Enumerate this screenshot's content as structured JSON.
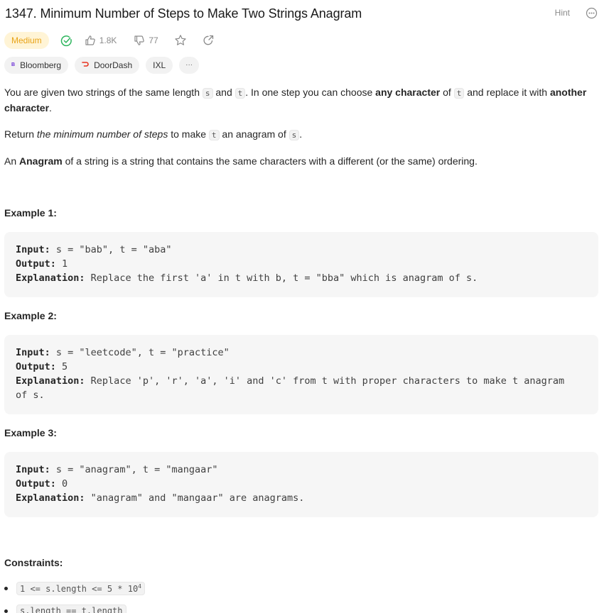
{
  "problem": {
    "title": "1347. Minimum Number of Steps to Make Two Strings Anagram",
    "hint_label": "Hint",
    "difficulty": "Medium",
    "likes": "1.8K",
    "dislikes": "77"
  },
  "companies": [
    {
      "name": "Bloomberg",
      "logo": "B"
    },
    {
      "name": "DoorDash"
    },
    {
      "name": "IXL"
    }
  ],
  "more_tags_label": "···",
  "description": {
    "p1_a": "You are given two strings of the same length ",
    "p1_s": "s",
    "p1_b": " and ",
    "p1_t": "t",
    "p1_c": ". In one step you can choose ",
    "p1_bold1": "any character",
    "p1_d": " of ",
    "p1_t2": "t",
    "p1_e": " and replace it with ",
    "p1_bold2": "another character",
    "p1_f": ".",
    "p2_a": "Return ",
    "p2_ital": "the minimum number of steps",
    "p2_b": " to make ",
    "p2_t": "t",
    "p2_c": " an anagram of ",
    "p2_s": "s",
    "p2_d": ".",
    "p3_a": "An ",
    "p3_bold": "Anagram",
    "p3_b": " of a string is a string that contains the same characters with a different (or the same) ordering."
  },
  "examples": [
    {
      "title": "Example 1:",
      "input_label": "Input:",
      "input": " s = \"bab\", t = \"aba\"",
      "output_label": "Output:",
      "output": " 1",
      "explanation_label": "Explanation:",
      "explanation": " Replace the first 'a' in t with b, t = \"bba\" which is anagram of s."
    },
    {
      "title": "Example 2:",
      "input_label": "Input:",
      "input": " s = \"leetcode\", t = \"practice\"",
      "output_label": "Output:",
      "output": " 5",
      "explanation_label": "Explanation:",
      "explanation": " Replace 'p', 'r', 'a', 'i' and 'c' from t with proper characters to make t anagram",
      "explanation_cont": "of s."
    },
    {
      "title": "Example 3:",
      "input_label": "Input:",
      "input": " s = \"anagram\", t = \"mangaar\"",
      "output_label": "Output:",
      "output": " 0",
      "explanation_label": "Explanation:",
      "explanation": " \"anagram\" and \"mangaar\" are anagrams."
    }
  ],
  "constraints": {
    "title": "Constraints:",
    "c1_base": "1 <= s.length <= 5 * 10",
    "c1_exp": "4",
    "c2": "s.length == t.length"
  }
}
